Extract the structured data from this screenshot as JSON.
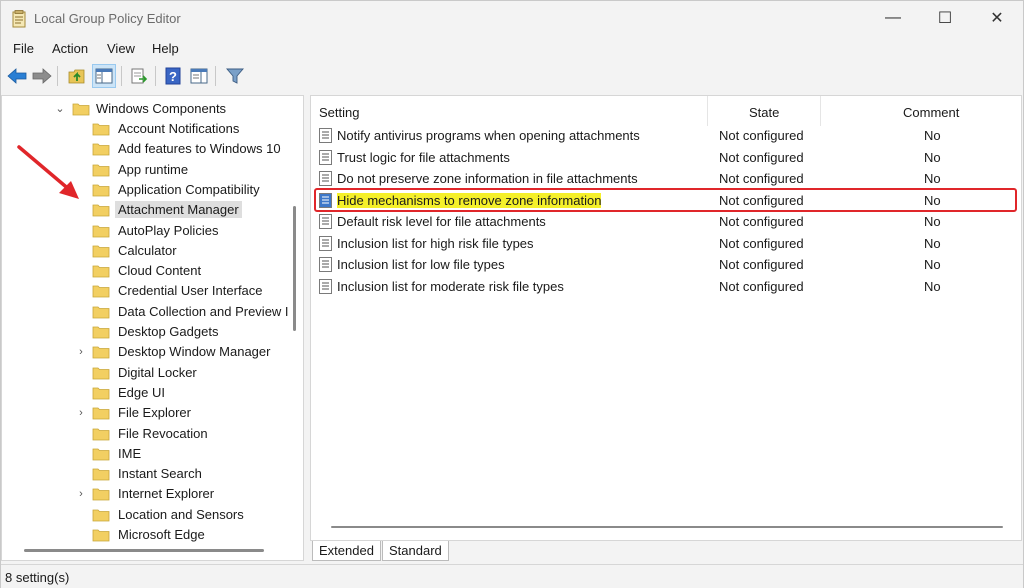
{
  "window": {
    "title": "Local Group Policy Editor",
    "controls": {
      "minimize": "—",
      "maximize": "☐",
      "close": "✕"
    }
  },
  "menu": [
    "File",
    "Action",
    "View",
    "Help"
  ],
  "toolbar": {
    "icons": [
      "back-icon",
      "forward-icon",
      "up-folder-icon",
      "show-hide-tree-icon",
      "export-list-icon",
      "help-icon",
      "show-hide-action-pane-icon",
      "filter-icon"
    ]
  },
  "tree": {
    "root": "Windows Components",
    "items": [
      {
        "label": "Account Notifications",
        "expandable": false
      },
      {
        "label": "Add features to Windows 10",
        "expandable": false
      },
      {
        "label": "App runtime",
        "expandable": false
      },
      {
        "label": "Application Compatibility",
        "expandable": false
      },
      {
        "label": "Attachment Manager",
        "expandable": false,
        "selected": true
      },
      {
        "label": "AutoPlay Policies",
        "expandable": false
      },
      {
        "label": "Calculator",
        "expandable": false
      },
      {
        "label": "Cloud Content",
        "expandable": false
      },
      {
        "label": "Credential User Interface",
        "expandable": false
      },
      {
        "label": "Data Collection and Preview I",
        "expandable": false
      },
      {
        "label": "Desktop Gadgets",
        "expandable": false
      },
      {
        "label": "Desktop Window Manager",
        "expandable": true
      },
      {
        "label": "Digital Locker",
        "expandable": false
      },
      {
        "label": "Edge UI",
        "expandable": false
      },
      {
        "label": "File Explorer",
        "expandable": true
      },
      {
        "label": "File Revocation",
        "expandable": false
      },
      {
        "label": "IME",
        "expandable": false
      },
      {
        "label": "Instant Search",
        "expandable": false
      },
      {
        "label": "Internet Explorer",
        "expandable": true
      },
      {
        "label": "Location and Sensors",
        "expandable": false
      },
      {
        "label": "Microsoft Edge",
        "expandable": false
      }
    ]
  },
  "list": {
    "columns": {
      "setting": "Setting",
      "state": "State",
      "comment": "Comment"
    },
    "rows": [
      {
        "setting": "Notify antivirus programs when opening attachments",
        "state": "Not configured",
        "comment": "No"
      },
      {
        "setting": "Trust logic for file attachments",
        "state": "Not configured",
        "comment": "No"
      },
      {
        "setting": "Do not preserve zone information in file attachments",
        "state": "Not configured",
        "comment": "No"
      },
      {
        "setting": "Hide mechanisms to remove zone information",
        "state": "Not configured",
        "comment": "No",
        "highlighted": true
      },
      {
        "setting": "Default risk level for file attachments",
        "state": "Not configured",
        "comment": "No"
      },
      {
        "setting": "Inclusion list for high risk file types",
        "state": "Not configured",
        "comment": "No"
      },
      {
        "setting": "Inclusion list for low file types",
        "state": "Not configured",
        "comment": "No"
      },
      {
        "setting": "Inclusion list for moderate risk file types",
        "state": "Not configured",
        "comment": "No"
      }
    ]
  },
  "tabs": [
    "Extended",
    "Standard"
  ],
  "status": "8 setting(s)",
  "colors": {
    "highlight": "#f5f02a",
    "annotation": "#e0262a",
    "selection": "#dedede"
  }
}
